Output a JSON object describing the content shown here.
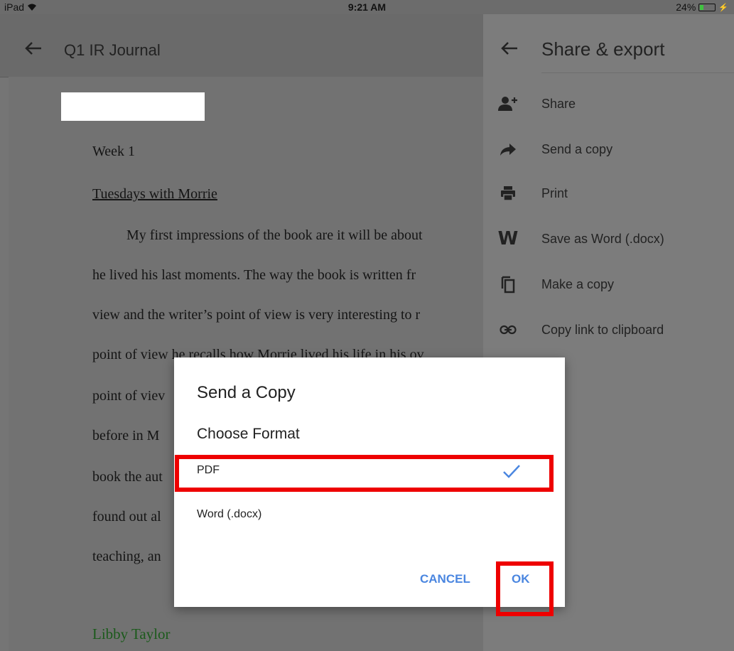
{
  "status_bar": {
    "device": "iPad",
    "time": "9:21 AM",
    "battery": "24%",
    "battery_color": "#3fc33f"
  },
  "doc": {
    "title": "Q1 IR Journal",
    "lines": [
      "Week 1",
      "Tuesdays with Morrie",
      "My first impressions of the book are it will be about",
      "he lived his last moments. The way the book is written fr",
      "view and the writer’s point of view is very interesting to r",
      "point of view he recalls how Morrie lived his life in his ov",
      "point of viev",
      "before in M",
      "book the aut",
      "found out al",
      "teaching, an"
    ],
    "author": "Libby Taylor",
    "author_color": "#1b5a1b"
  },
  "panel": {
    "title": "Share & export",
    "items": [
      {
        "label": "Share",
        "icon": "add-person-icon"
      },
      {
        "label": "Send a copy",
        "icon": "forward-arrow-icon"
      },
      {
        "label": "Print",
        "icon": "printer-icon"
      },
      {
        "label": "Save as Word (.docx)",
        "icon": "word-icon"
      },
      {
        "label": "Make a copy",
        "icon": "copy-icon"
      },
      {
        "label": "Copy link to clipboard",
        "icon": "link-icon"
      }
    ]
  },
  "dialog": {
    "title": "Send a Copy",
    "subtitle": "Choose Format",
    "options": [
      {
        "label": "PDF",
        "selected": true
      },
      {
        "label": "Word (.docx)",
        "selected": false
      }
    ],
    "cancel_label": "CANCEL",
    "ok_label": "OK",
    "accent_color": "#4a86e0",
    "highlight_color": "#ee0000"
  }
}
